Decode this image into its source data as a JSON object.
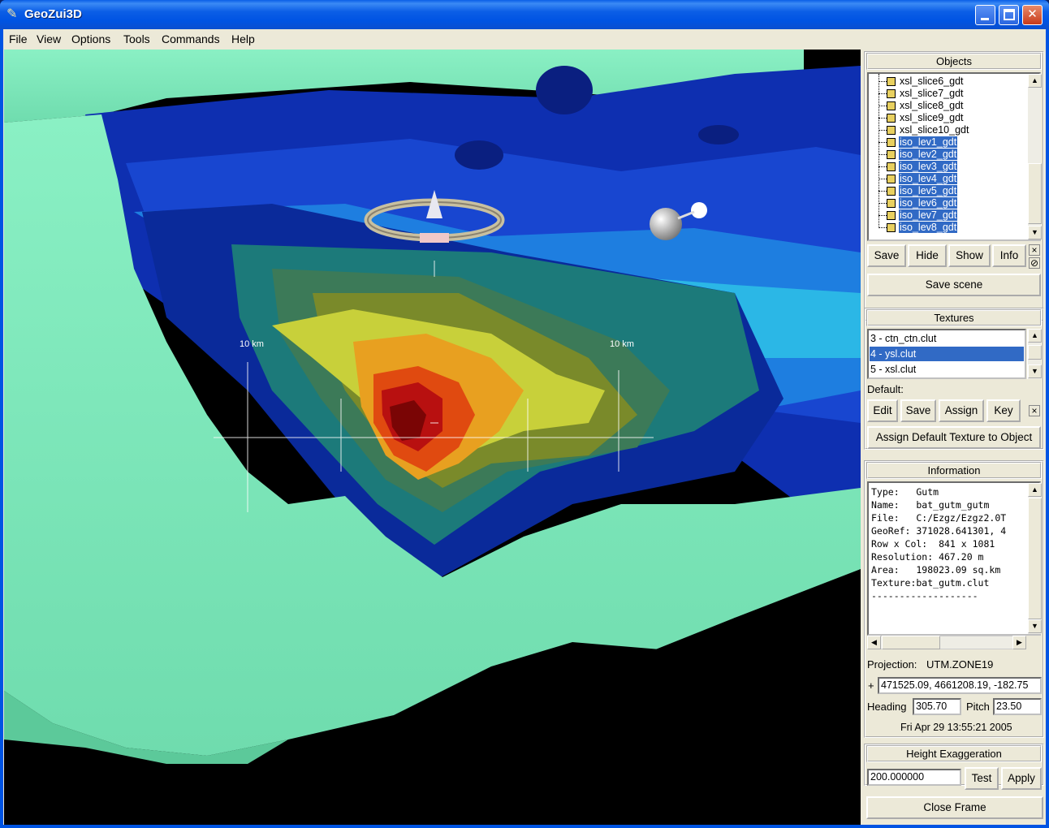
{
  "window": {
    "title": "GeoZui3D",
    "minimize": "_",
    "maximize": "□",
    "close": "✕"
  },
  "menu": [
    "File",
    "View",
    "Options",
    "Tools",
    "Commands",
    "Help"
  ],
  "viewport": {
    "scale_label_left": "10 km",
    "scale_label_right": "10 km"
  },
  "objects": {
    "title": "Objects",
    "items": [
      {
        "label": "xsl_slice6_gdt",
        "selected": false
      },
      {
        "label": "xsl_slice7_gdt",
        "selected": false
      },
      {
        "label": "xsl_slice8_gdt",
        "selected": false
      },
      {
        "label": "xsl_slice9_gdt",
        "selected": false
      },
      {
        "label": "xsl_slice10_gdt",
        "selected": false
      },
      {
        "label": "iso_lev1_gdt",
        "selected": true
      },
      {
        "label": "iso_lev2_gdt",
        "selected": true
      },
      {
        "label": "iso_lev3_gdt",
        "selected": true
      },
      {
        "label": "iso_lev4_gdt",
        "selected": true
      },
      {
        "label": "iso_lev5_gdt",
        "selected": true
      },
      {
        "label": "iso_lev6_gdt",
        "selected": true
      },
      {
        "label": "iso_lev7_gdt",
        "selected": true
      },
      {
        "label": "iso_lev8_gdt",
        "selected": true
      }
    ],
    "buttons": {
      "save": "Save",
      "hide": "Hide",
      "show": "Show",
      "info": "Info"
    },
    "save_scene": "Save scene"
  },
  "textures": {
    "title": "Textures",
    "items": [
      {
        "label": "3 - ctn_ctn.clut",
        "selected": false
      },
      {
        "label": "4 - ysl.clut",
        "selected": true
      },
      {
        "label": "5 - xsl.clut",
        "selected": false
      }
    ],
    "default_label": "Default:",
    "buttons": {
      "edit": "Edit",
      "save": "Save",
      "assign": "Assign",
      "key": "Key"
    },
    "assign_default": "Assign Default Texture to Object"
  },
  "information": {
    "title": "Information",
    "lines": [
      "Type:   Gutm",
      "Name:   bat_gutm_gutm",
      "File:   C:/Ezgz/Ezgz2.0T",
      "GeoRef: 371028.641301, 4",
      "Row x Col:  841 x 1081",
      "Resolution: 467.20 m",
      "Area:   198023.09 sq.km",
      "Texture:bat_gutm.clut",
      "-------------------"
    ],
    "projection_label": "Projection:",
    "projection_value": "UTM.ZONE19",
    "position_prefix": "+",
    "position_value": "471525.09, 4661208.19, -182.75",
    "heading_label": "Heading",
    "heading_value": "305.70",
    "pitch_label": "Pitch",
    "pitch_value": "23.50",
    "timestamp": "Fri Apr 29 13:55:21 2005"
  },
  "height_exaggeration": {
    "title": "Height Exaggeration",
    "value": "200.000000",
    "test": "Test",
    "apply": "Apply"
  },
  "close_frame": "Close Frame",
  "colors": {
    "selection": "#316ac5",
    "titlebar": "#0054e3",
    "seafloor": "#7fe8b8"
  }
}
